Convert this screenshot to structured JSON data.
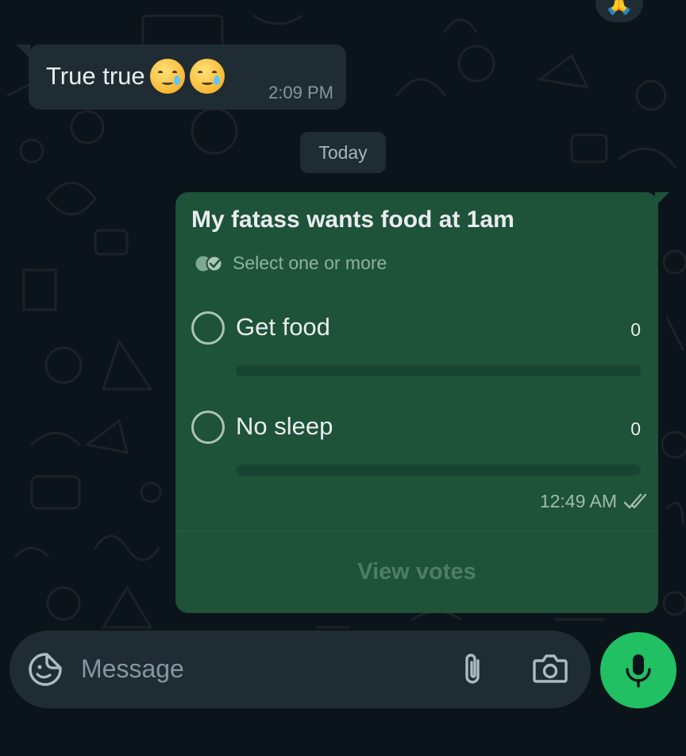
{
  "reaction": {
    "emoji": "🙏"
  },
  "incoming_message": {
    "text": "True true",
    "emojis": [
      "smiling-face-with-tear",
      "smiling-face-with-tear"
    ],
    "time": "2:09 PM"
  },
  "date_chip": {
    "label": "Today"
  },
  "poll": {
    "question": "My fatass wants food at 1am",
    "instruction": "Select one or more",
    "options": [
      {
        "label": "Get food",
        "votes": "0",
        "fraction": 0
      },
      {
        "label": "No sleep",
        "votes": "0",
        "fraction": 0
      }
    ],
    "time": "12:49 AM",
    "status": "read",
    "view_votes_label": "View votes"
  },
  "composer": {
    "placeholder": "Message"
  },
  "colors": {
    "background": "#0b141a",
    "incoming_bubble": "#1f2c33",
    "outgoing_bubble": "#1e5239",
    "mic_button": "#21c063",
    "secondary_text": "#8696a0"
  },
  "icons": {
    "sticker": "sticker-icon",
    "attach": "paperclip-icon",
    "camera": "camera-icon",
    "mic": "microphone-icon",
    "double_check": "double-check-icon",
    "poll": "poll-check-icon"
  }
}
